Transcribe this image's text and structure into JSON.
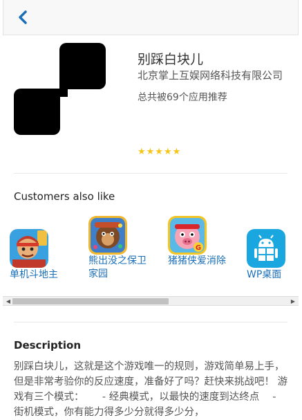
{
  "header": {
    "back_label": ""
  },
  "app": {
    "title": "别踩白块儿",
    "developer": "北京掌上互娱网络科技有限公司",
    "recommend": "总共被69个应用推荐",
    "stars": "★★★★★",
    "rating_stars": 5
  },
  "also_like": {
    "heading": "Customers also like",
    "items": [
      {
        "name": "单机斗地主",
        "icon": "doudizhu-game-icon"
      },
      {
        "name": "熊出没之保卫家园",
        "icon": "xiongchumo-game-icon"
      },
      {
        "name": "猪猪侠爱消除",
        "icon": "zhuzhuxia-game-icon"
      },
      {
        "name": "WP桌面",
        "icon": "android-wp-icon"
      }
    ]
  },
  "description": {
    "heading": "Description",
    "text": "别踩白块儿，这就是这个游戏唯一的规则，游戏简单易上手，但是非常考验你的反应速度，准备好了吗？赶快来挑战吧！ 游戏有三个模式：　　 - 经典模式，以最快的速度到达终点　 - 街机模式，你有能力得多少分就得多少分，"
  },
  "colors": {
    "accent": "#1a6fb8",
    "star": "#f5c518"
  }
}
